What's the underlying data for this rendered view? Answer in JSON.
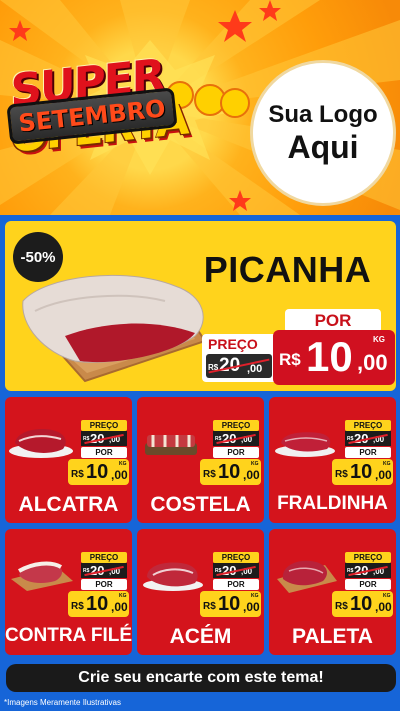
{
  "header": {
    "title_line1": "SUPER",
    "title_line2": "OFERTA",
    "month": "SETEMBRO",
    "logo_line1": "Sua Logo",
    "logo_line2": "Aqui"
  },
  "featured": {
    "discount": "-50%",
    "name": "PICANHA",
    "por_label": "POR",
    "preco_label": "PREÇO",
    "currency": "R$",
    "old_price_int": "20",
    "old_price_cents": ",00",
    "new_price_int": "10",
    "new_price_cents": ",00",
    "unit": "KG"
  },
  "price_labels": {
    "preco": "PREÇO",
    "por": "POR",
    "currency": "R$",
    "unit": "KG"
  },
  "products": [
    {
      "name": "ALCATRA",
      "old_int": "20",
      "old_cents": ",00",
      "new_int": "10",
      "new_cents": ",00"
    },
    {
      "name": "COSTELA",
      "old_int": "20",
      "old_cents": ",00",
      "new_int": "10",
      "new_cents": ",00"
    },
    {
      "name": "FRALDINHA",
      "old_int": "20",
      "old_cents": ",00",
      "new_int": "10",
      "new_cents": ",00"
    },
    {
      "name": "CONTRA FILÉ",
      "old_int": "20",
      "old_cents": ",00",
      "new_int": "10",
      "new_cents": ",00"
    },
    {
      "name": "ACÉM",
      "old_int": "20",
      "old_cents": ",00",
      "new_int": "10",
      "new_cents": ",00"
    },
    {
      "name": "PALETA",
      "old_int": "20",
      "old_cents": ",00",
      "new_int": "10",
      "new_cents": ",00"
    }
  ],
  "footer": {
    "cta": "Crie seu encarte com este tema!",
    "disclaimer": "*Imagens Meramente Ilustrativas"
  },
  "colors": {
    "red": "#d4141c",
    "yellow": "#ffd31c",
    "blue": "#1665d8",
    "dark": "#1a1a1a"
  }
}
